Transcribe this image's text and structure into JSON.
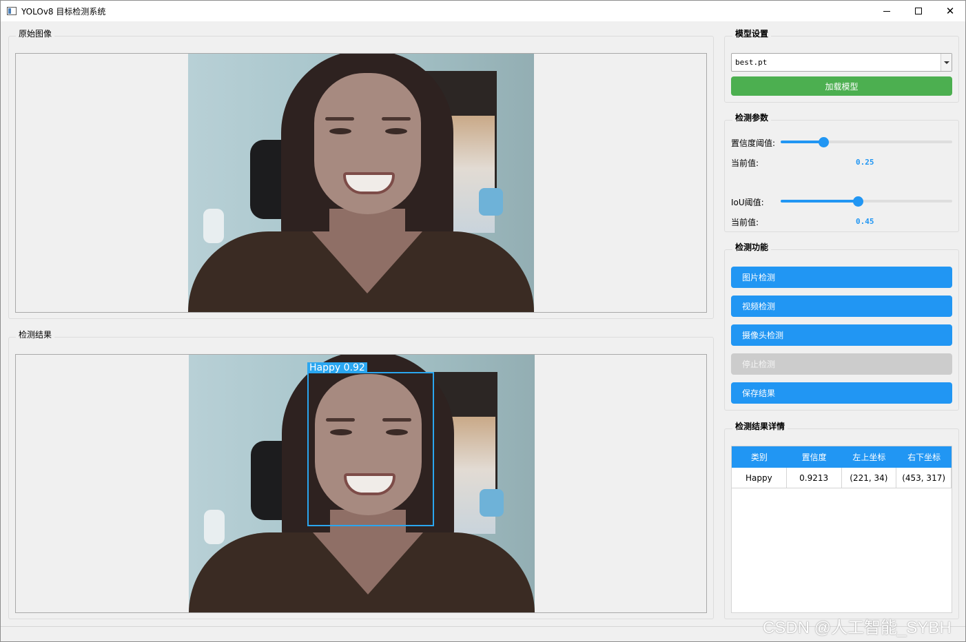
{
  "window": {
    "title": "YOLOv8 目标检测系统",
    "minimize_symbol": "",
    "close_symbol": "✕"
  },
  "original_panel": {
    "title": "原始图像"
  },
  "result_panel": {
    "title": "检测结果",
    "detection": {
      "label": "Happy  0.92"
    }
  },
  "model_settings": {
    "title": "模型设置",
    "model_select": {
      "value": "best.pt"
    },
    "load_button": "加载模型"
  },
  "detect_params": {
    "title": "检测参数",
    "confidence": {
      "label": "置信度阈值:",
      "current_label": "当前值:",
      "value_text": "0.25",
      "value": 0.25
    },
    "iou": {
      "label": "IoU阈值:",
      "current_label": "当前值:",
      "value_text": "0.45",
      "value": 0.45
    }
  },
  "detect_functions": {
    "title": "检测功能",
    "image_detect": "图片检测",
    "video_detect": "视频检测",
    "camera_detect": "摄像头检测",
    "stop_detect": "停止检测",
    "save_result": "保存结果"
  },
  "result_details": {
    "title": "检测结果详情",
    "headers": [
      "类别",
      "置信度",
      "左上坐标",
      "右下坐标"
    ],
    "rows": [
      [
        "Happy",
        "0.9213",
        "(221, 34)",
        "(453, 317)"
      ]
    ]
  },
  "watermark": "CSDN @人工智能_SYBH",
  "colors": {
    "accent_blue": "#2196f3",
    "load_green": "#4caf50",
    "disabled_grey": "#cccccc",
    "detection_box": "#2aa6f0"
  }
}
